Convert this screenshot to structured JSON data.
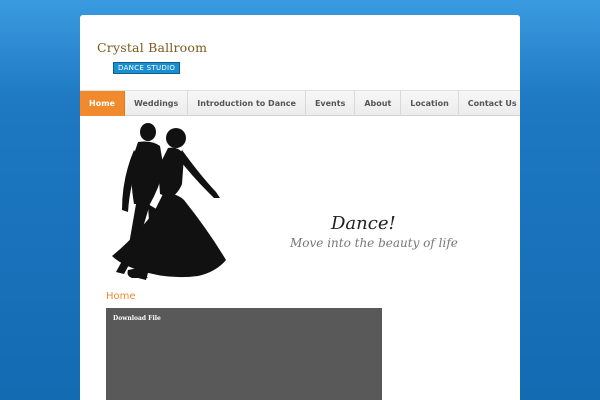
{
  "logo": {
    "line1": "Crystal Ballroom",
    "line2": "DANCE STUDIO"
  },
  "nav": {
    "items": [
      {
        "label": "Home",
        "active": true
      },
      {
        "label": "Weddings"
      },
      {
        "label": "Introduction to Dance"
      },
      {
        "label": "Events"
      },
      {
        "label": "About"
      },
      {
        "label": "Location"
      },
      {
        "label": "Contact Us"
      }
    ]
  },
  "hero": {
    "title": "Dance!",
    "subtitle": "Move into the beauty of life"
  },
  "section": {
    "title": "Home"
  },
  "download": {
    "label": "Download File"
  },
  "colors": {
    "accent": "#f08a2c",
    "background": "#136bb2",
    "logo_badge": "#1a8fd0"
  }
}
